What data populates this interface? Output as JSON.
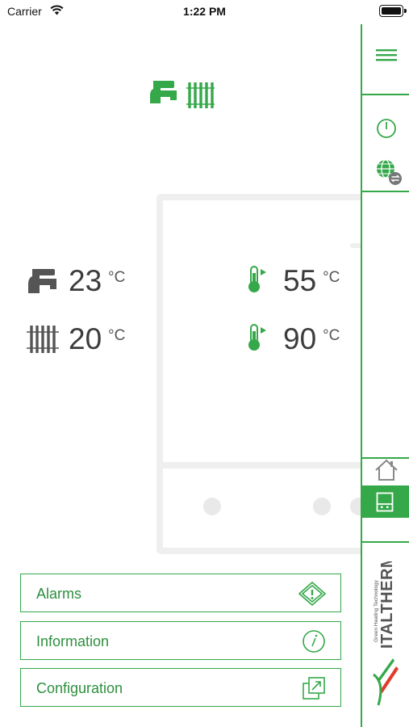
{
  "status_bar": {
    "carrier": "Carrier",
    "time": "1:22 PM"
  },
  "readings": {
    "dhw": {
      "value": "23",
      "unit": "°C",
      "icon": "tap-icon"
    },
    "heating": {
      "value": "20",
      "unit": "°C",
      "icon": "radiator-icon"
    },
    "temp_1": {
      "value": "55",
      "unit": "°C",
      "icon": "thermometer-icon"
    },
    "temp_2": {
      "value": "90",
      "unit": "°C",
      "icon": "thermometer-icon"
    }
  },
  "mode": {
    "icon": "tap-radiator-mode-icon"
  },
  "menu": {
    "alarms": {
      "label": "Alarms",
      "icon": "alarm-warning-icon"
    },
    "information": {
      "label": "Information",
      "icon": "info-icon"
    },
    "configuration": {
      "label": "Configuration",
      "icon": "configuration-icon"
    }
  },
  "sidebar": {
    "items": [
      "hamburger-menu-icon",
      "power-icon",
      "globe-switch-icon",
      "home-icon",
      "boiler-panel-icon"
    ],
    "active": "boiler-panel-icon"
  },
  "brand": {
    "name": "ITALTHERM",
    "tagline": "Green Heating Technology"
  },
  "colors": {
    "accent": "#35a84a",
    "text": "#3c3c3c",
    "outline": "#efefef"
  }
}
